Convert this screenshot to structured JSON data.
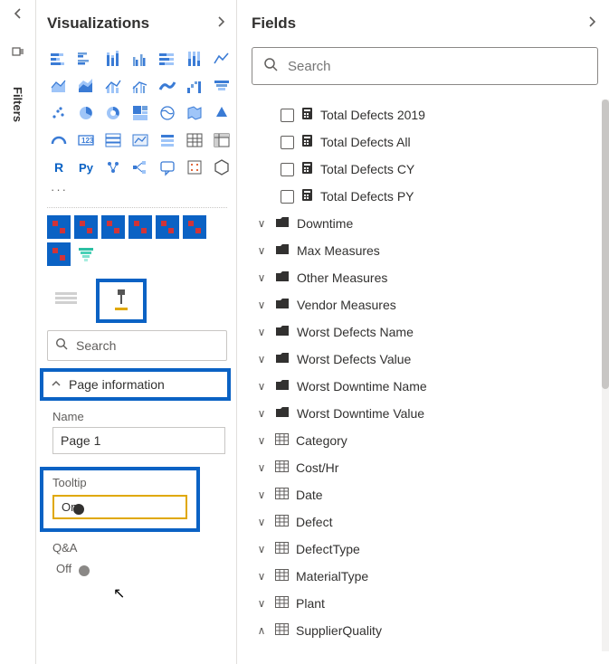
{
  "rail": {
    "filters_label": "Filters"
  },
  "viz": {
    "title": "Visualizations",
    "ellipsis": "···",
    "search_placeholder": "Search",
    "page_info_label": "Page information",
    "name_label": "Name",
    "name_value": "Page 1",
    "tooltip_label": "Tooltip",
    "tooltip_state": "On",
    "qa_label": "Q&A",
    "qa_state": "Off"
  },
  "fields": {
    "title": "Fields",
    "search_placeholder": "Search",
    "measures": [
      "Total Defects 2019",
      "Total Defects All",
      "Total Defects CY",
      "Total Defects PY"
    ],
    "folders": [
      "Downtime",
      "Max Measures",
      "Other Measures",
      "Vendor Measures",
      "Worst Defects Name",
      "Worst Defects Value",
      "Worst Downtime Name",
      "Worst Downtime Value"
    ],
    "tables": [
      "Category",
      "Cost/Hr",
      "Date",
      "Defect",
      "DefectType",
      "MaterialType",
      "Plant",
      "SupplierQuality"
    ]
  }
}
